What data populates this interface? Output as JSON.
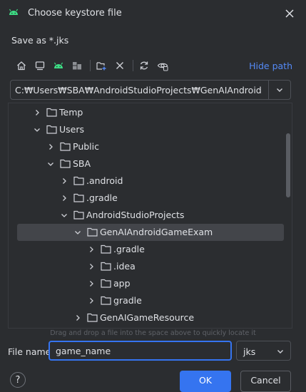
{
  "window": {
    "title": "Choose keystore file",
    "app_icon": "android-icon",
    "close_icon": "close-icon"
  },
  "subtitle": "Save as *.jks",
  "toolbar": {
    "buttons": [
      {
        "icon": "home-icon"
      },
      {
        "icon": "desktop-icon"
      },
      {
        "icon": "android-project-icon"
      },
      {
        "icon": "module-icon"
      },
      {
        "icon": "new-folder-icon"
      },
      {
        "icon": "delete-icon"
      },
      {
        "icon": "refresh-icon"
      },
      {
        "icon": "show-hidden-icon"
      }
    ],
    "hide_path": "Hide path"
  },
  "path": {
    "value": "C:₩Users₩SBA₩AndroidStudioProjects₩GenAIAndroidGameExam"
  },
  "tree": {
    "rows": [
      {
        "label": "Temp",
        "level": 2,
        "expanded": false
      },
      {
        "label": "Users",
        "level": 2,
        "expanded": true
      },
      {
        "label": "Public",
        "level": 3,
        "expanded": false
      },
      {
        "label": "SBA",
        "level": 3,
        "expanded": true
      },
      {
        "label": ".android",
        "level": 4,
        "expanded": false
      },
      {
        "label": ".gradle",
        "level": 4,
        "expanded": false
      },
      {
        "label": "AndroidStudioProjects",
        "level": 4,
        "expanded": true
      },
      {
        "label": "GenAIAndroidGameExam",
        "level": 5,
        "expanded": true,
        "selected": true
      },
      {
        "label": ".gradle",
        "level": 6,
        "expanded": false
      },
      {
        "label": ".idea",
        "level": 6,
        "expanded": false
      },
      {
        "label": "app",
        "level": 6,
        "expanded": false
      },
      {
        "label": "gradle",
        "level": 6,
        "expanded": false
      },
      {
        "label": "GenAIGameResource",
        "level": 5,
        "expanded": false
      }
    ]
  },
  "hint": "Drag and drop a file into the space above to quickly locate it",
  "file_name": {
    "label": "File name:",
    "value": "game_name",
    "extension": "jks"
  },
  "buttons": {
    "help": "?",
    "ok": "OK",
    "cancel": "Cancel"
  },
  "colors": {
    "background": "#2b2d30",
    "accent": "#3574f0",
    "link": "#548af7",
    "android_green": "#3ddc84",
    "selected_row": "#43454a"
  }
}
